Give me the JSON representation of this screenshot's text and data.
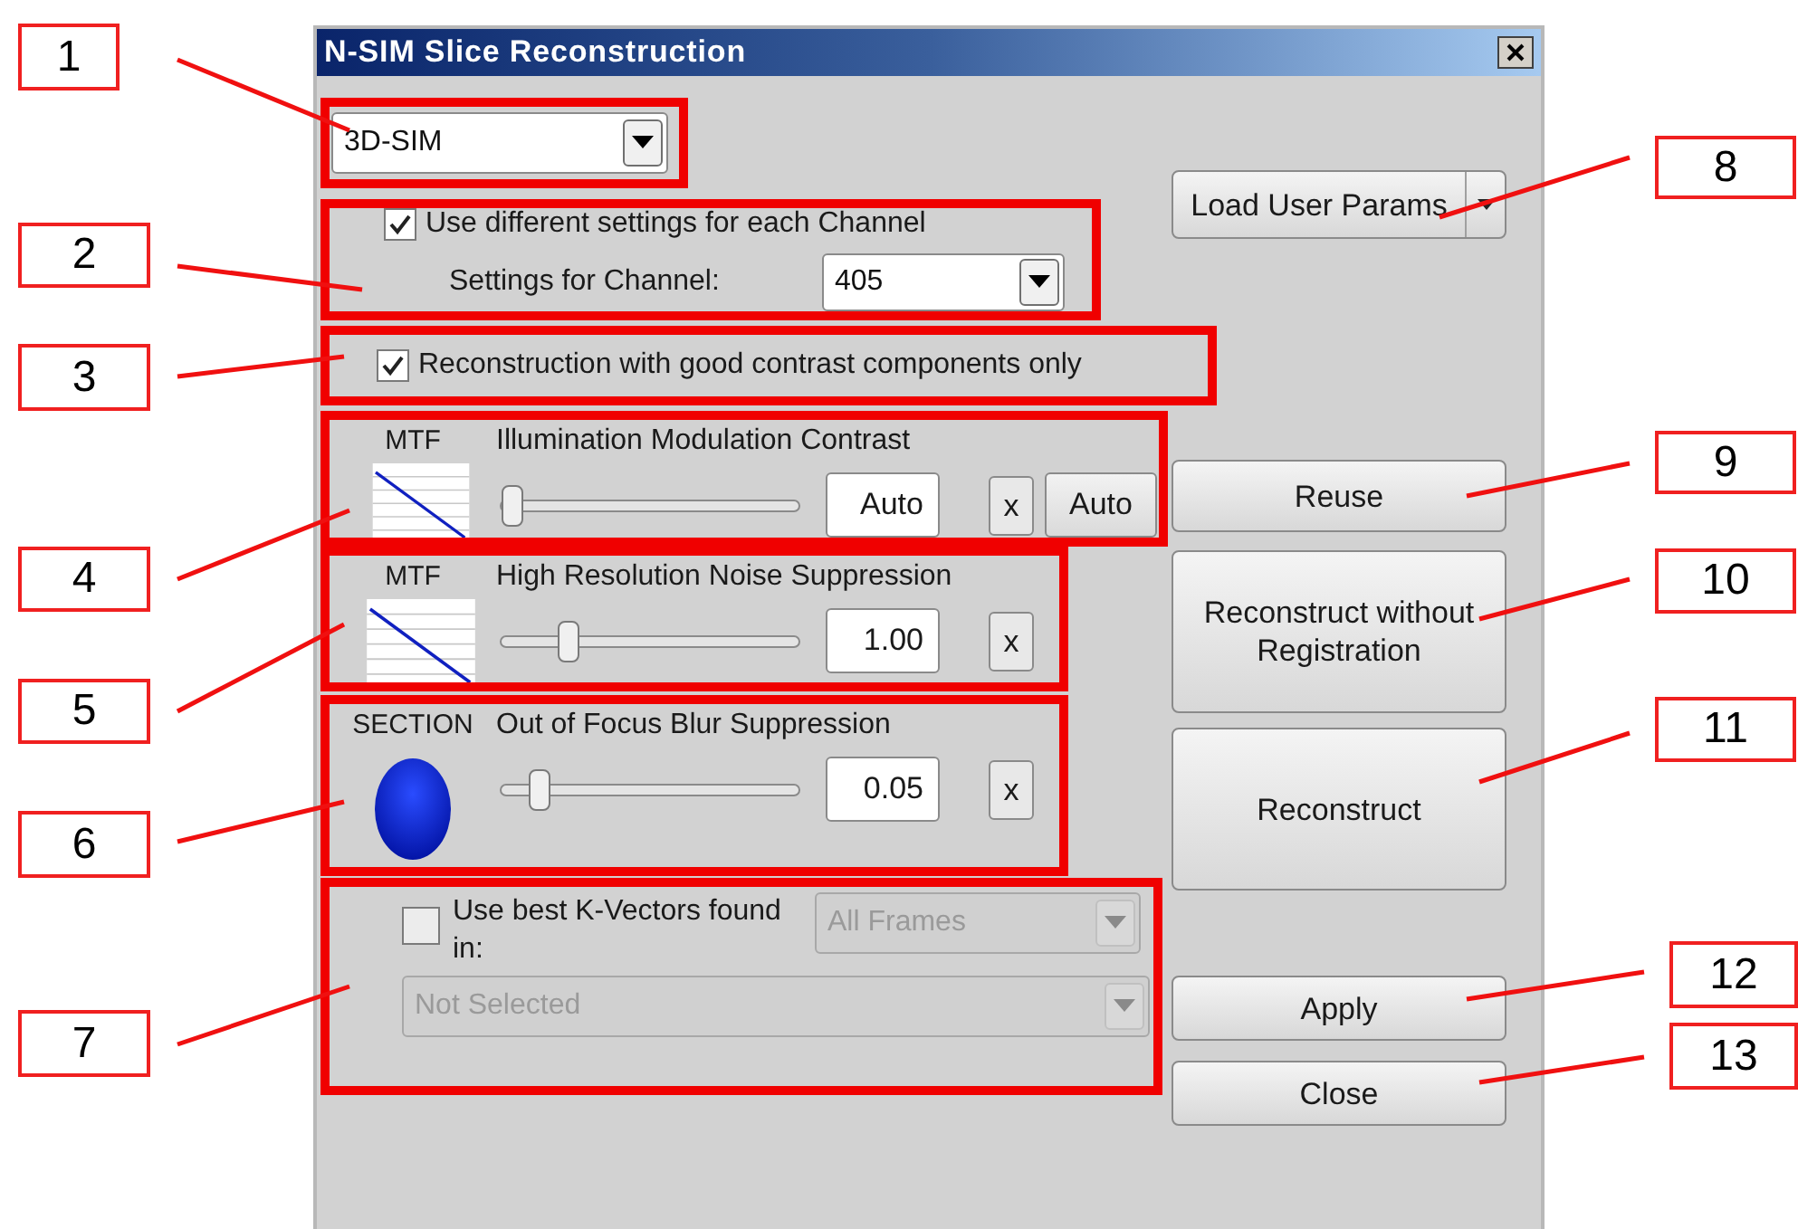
{
  "window": {
    "title": "N-SIM Slice Reconstruction"
  },
  "mode": {
    "value": "3D-SIM"
  },
  "channel_settings": {
    "label": "Use different settings for each Channel",
    "checked": true,
    "channel_label": "Settings for Channel:",
    "channel_value": "405"
  },
  "good_contrast": {
    "label": "Reconstruction with good contrast components only",
    "checked": true
  },
  "parameters": [
    {
      "kind": "mtf",
      "caption": "MTF",
      "title": "Illumination Modulation Contrast",
      "level": 0,
      "value": "Auto",
      "reset": "x",
      "auto_button": "Auto"
    },
    {
      "kind": "mtf",
      "caption": "MTF",
      "title": "High Resolution Noise Suppression",
      "level": 0.2,
      "value": "1.00",
      "reset": "x"
    },
    {
      "kind": "section",
      "caption": "SECTION",
      "title": "Out of Focus Blur Suppression",
      "level": 0.1,
      "value": "0.05",
      "reset": "x"
    }
  ],
  "k_vectors": {
    "label": "Use best K-Vectors found in:",
    "checked": false,
    "frames": "All Frames",
    "source": "Not Selected",
    "disabled": true
  },
  "buttons": {
    "load_user_params": "Load User Params",
    "reuse": "Reuse",
    "reconstruct_without_registration": "Reconstruct without Registration",
    "reconstruct": "Reconstruct",
    "apply": "Apply",
    "close": "Close"
  },
  "callouts": [
    "1",
    "2",
    "3",
    "4",
    "5",
    "6",
    "7",
    "8",
    "9",
    "10",
    "11",
    "12",
    "13"
  ]
}
